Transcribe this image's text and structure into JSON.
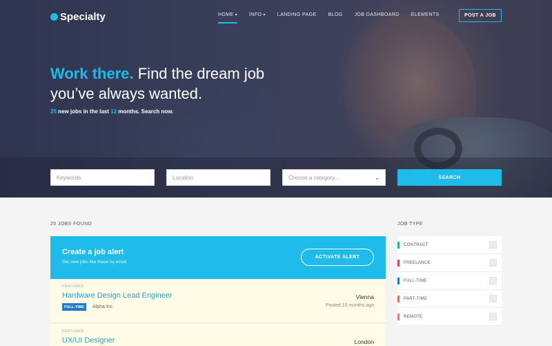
{
  "brand": {
    "name": "Specialty",
    "accent": "#1fbbea"
  },
  "nav": {
    "items": [
      {
        "label": "HOME",
        "caret": "▾"
      },
      {
        "label": "INFO",
        "caret": "▾"
      },
      {
        "label": "LANDING PAGE"
      },
      {
        "label": "BLOG"
      },
      {
        "label": "JOB DASHBOARD"
      },
      {
        "label": "ELEMENTS"
      }
    ],
    "post_button": "POST A JOB"
  },
  "hero": {
    "headline_highlight": "Work there.",
    "headline_rest": " Find the dream job you’ve always wanted.",
    "sub_count": "25",
    "sub_mid": " new jobs in the last ",
    "sub_months": "12",
    "sub_end": " months. Search now."
  },
  "search": {
    "keywords_placeholder": "Keywords",
    "location_placeholder": "Location",
    "category_placeholder": "Choose a category...",
    "button": "SEARCH"
  },
  "results": {
    "count_label": "25 JOBS FOUND"
  },
  "alert": {
    "title": "Create a job alert",
    "subtitle": "Get new jobs like these by email",
    "button": "ACTIVATE ALERT"
  },
  "jobs": [
    {
      "featured": "FEATURED",
      "title": "Hardware Design Lead Engineer",
      "type": "FULL-TIME",
      "company": "Alpha Inc",
      "location": "Vienna",
      "posted": "Posted 10 months ago"
    },
    {
      "featured": "FEATURED",
      "title": "UX/UI Designer",
      "type": "",
      "company": "",
      "location": "London",
      "posted": ""
    }
  ],
  "sidebar": {
    "title": "JOB TYPE",
    "types": [
      {
        "label": "CONTRACT",
        "color": "#19b5ad"
      },
      {
        "label": "FREELANCE",
        "color": "#e83e6a"
      },
      {
        "label": "FULL-TIME",
        "color": "#1f7bc4"
      },
      {
        "label": "PART-TIME",
        "color": "#f0714a"
      },
      {
        "label": "REMOTE",
        "color": "#e87f8c"
      }
    ]
  }
}
